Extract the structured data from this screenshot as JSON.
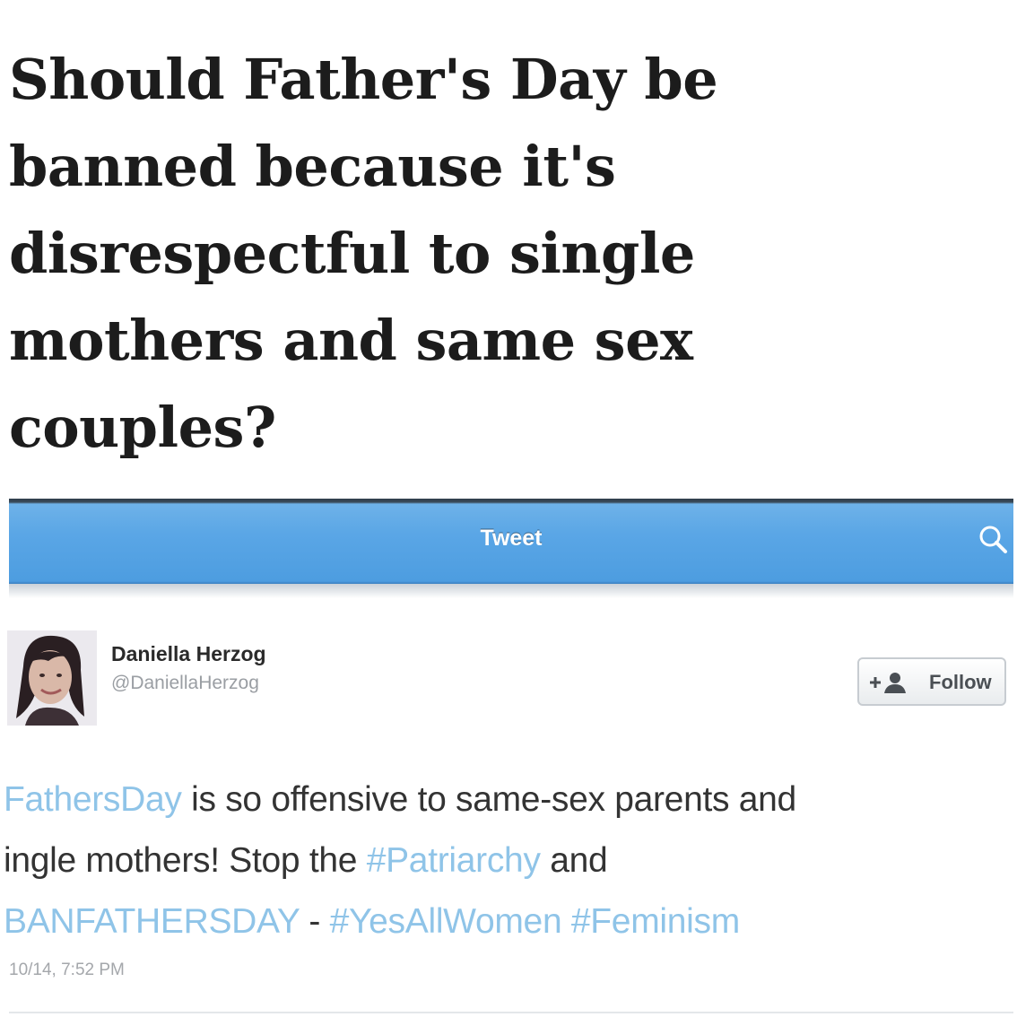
{
  "headline": {
    "lines": [
      "Should Father's Day be",
      "banned because it's",
      "disrespectful to single",
      "mothers and same sex",
      "couples?"
    ]
  },
  "navbar": {
    "title": "Tweet",
    "search_icon": "search-icon",
    "color": "#5aa6e6"
  },
  "tweet": {
    "author_name": "Daniella Herzog",
    "author_handle": "@DaniellaHerzog",
    "avatar_icon": "profile-photo",
    "follow_label": "Follow",
    "follow_icon": "add-user-icon",
    "line1": {
      "tag": "FathersDay",
      "text": " is so offensive to same-sex parents and"
    },
    "line2": {
      "text_a": "ingle mothers! Stop the ",
      "tag": "#Patriarchy",
      "text_b": " and"
    },
    "line3": {
      "tag_a": "BANFATHERSDAY",
      "text": " - ",
      "tag_b": "#YesAllWomen",
      "space": " ",
      "tag_c": "#Feminism"
    },
    "timestamp": "10/14, 7:52 PM",
    "hashtag_color": "#8fc4e8"
  }
}
